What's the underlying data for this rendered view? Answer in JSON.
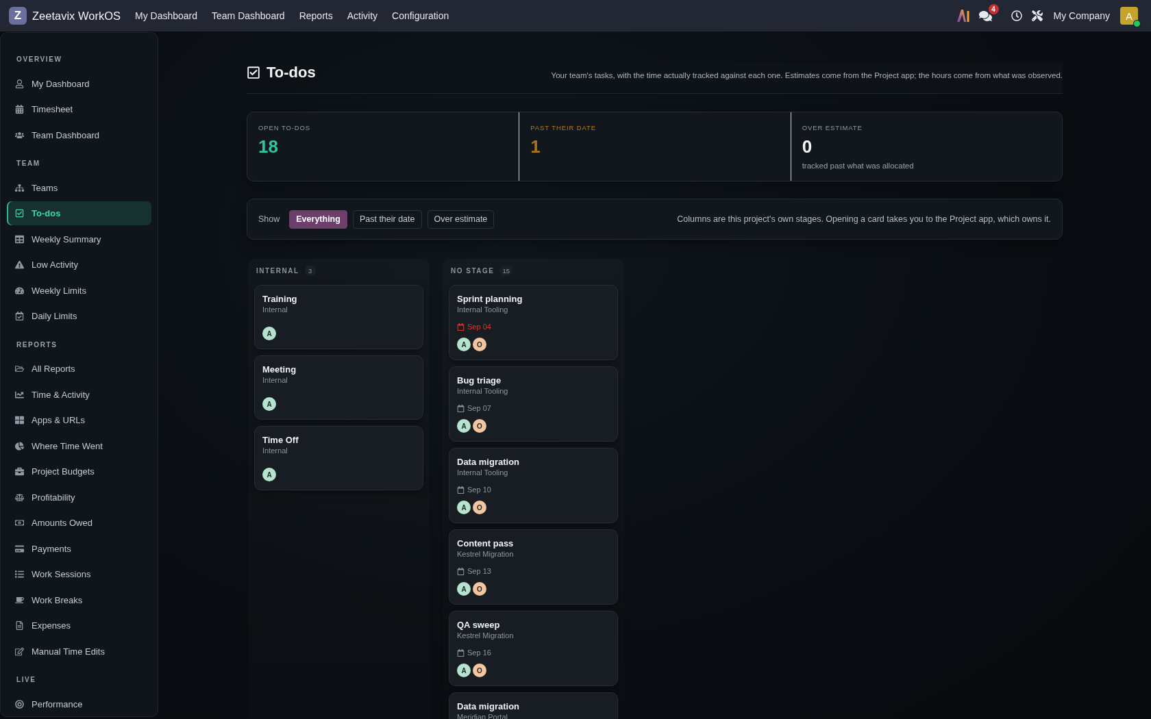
{
  "topbar": {
    "logo_letter": "Z",
    "brand": "Zeetavix WorkOS",
    "nav": [
      "My Dashboard",
      "Team Dashboard",
      "Reports",
      "Activity",
      "Configuration"
    ],
    "messages_badge": "4",
    "company": "My Company",
    "avatar": {
      "initial": "A",
      "online": true
    }
  },
  "sidebar": [
    {
      "heading": "OVERVIEW",
      "items": [
        {
          "label": "My Dashboard",
          "selected": false
        },
        {
          "label": "Timesheet",
          "selected": false
        },
        {
          "label": "Team Dashboard",
          "selected": false
        }
      ]
    },
    {
      "heading": "TEAM",
      "items": [
        {
          "label": "Teams",
          "selected": false
        },
        {
          "label": "To-dos",
          "selected": true
        },
        {
          "label": "Weekly Summary",
          "selected": false
        },
        {
          "label": "Low Activity",
          "selected": false
        },
        {
          "label": "Weekly Limits",
          "selected": false
        },
        {
          "label": "Daily Limits",
          "selected": false
        }
      ]
    },
    {
      "heading": "REPORTS",
      "items": [
        {
          "label": "All Reports",
          "selected": false
        },
        {
          "label": "Time & Activity",
          "selected": false
        },
        {
          "label": "Apps & URLs",
          "selected": false
        },
        {
          "label": "Where Time Went",
          "selected": false
        },
        {
          "label": "Project Budgets",
          "selected": false
        },
        {
          "label": "Profitability",
          "selected": false
        },
        {
          "label": "Amounts Owed",
          "selected": false
        },
        {
          "label": "Payments",
          "selected": false
        },
        {
          "label": "Work Sessions",
          "selected": false
        },
        {
          "label": "Work Breaks",
          "selected": false
        },
        {
          "label": "Expenses",
          "selected": false
        },
        {
          "label": "Manual Time Edits",
          "selected": false
        }
      ]
    },
    {
      "heading": "LIVE",
      "items": [
        {
          "label": "Performance",
          "selected": false
        }
      ]
    }
  ],
  "page": {
    "title": "To-dos",
    "description": "Your team's tasks, with the time actually tracked against each one. Estimates come from the Project app; the hours come from what was observed."
  },
  "stats": [
    {
      "kind": "accent",
      "label": "OPEN TO-DOS",
      "value": "18"
    },
    {
      "kind": "warning",
      "label": "PAST THEIR DATE",
      "value": "1"
    },
    {
      "kind": "plain",
      "label": "OVER ESTIMATE",
      "value": "0",
      "note": "tracked past what was allocated"
    }
  ],
  "filters": {
    "label": "Show",
    "chips": [
      {
        "label": "Everything",
        "selected": true
      },
      {
        "label": "Past their date",
        "selected": false
      },
      {
        "label": "Over estimate",
        "selected": false
      }
    ],
    "note": "Columns are this project's own stages. Opening a card takes you to the Project app, which owns it."
  },
  "columns": [
    {
      "title": "INTERNAL",
      "count": "3",
      "cards": [
        {
          "title": "Training",
          "project": "Internal",
          "assignees": [
            {
              "initial": "A",
              "color": "#b5e3cd"
            }
          ]
        },
        {
          "title": "Meeting",
          "project": "Internal",
          "assignees": [
            {
              "initial": "A",
              "color": "#b5e3cd"
            }
          ]
        },
        {
          "title": "Time Off",
          "project": "Internal",
          "assignees": [
            {
              "initial": "A",
              "color": "#b5e3cd"
            }
          ]
        }
      ]
    },
    {
      "title": "NO STAGE",
      "count": "15",
      "cards": [
        {
          "title": "Sprint planning",
          "project": "Internal Tooling",
          "date": "Sep 04",
          "overdue": true,
          "assignees": [
            {
              "initial": "A",
              "color": "#b5e3cd"
            },
            {
              "initial": "O",
              "color": "#f3c6a2"
            }
          ]
        },
        {
          "title": "Bug triage",
          "project": "Internal Tooling",
          "date": "Sep 07",
          "overdue": false,
          "assignees": [
            {
              "initial": "A",
              "color": "#b5e3cd"
            },
            {
              "initial": "O",
              "color": "#f3c6a2"
            }
          ]
        },
        {
          "title": "Data migration",
          "project": "Internal Tooling",
          "date": "Sep 10",
          "overdue": false,
          "assignees": [
            {
              "initial": "A",
              "color": "#b5e3cd"
            },
            {
              "initial": "O",
              "color": "#f3c6a2"
            }
          ]
        },
        {
          "title": "Content pass",
          "project": "Kestrel Migration",
          "date": "Sep 13",
          "overdue": false,
          "assignees": [
            {
              "initial": "A",
              "color": "#b5e3cd"
            },
            {
              "initial": "O",
              "color": "#f3c6a2"
            }
          ]
        },
        {
          "title": "QA sweep",
          "project": "Kestrel Migration",
          "date": "Sep 16",
          "overdue": false,
          "assignees": [
            {
              "initial": "A",
              "color": "#b5e3cd"
            },
            {
              "initial": "O",
              "color": "#f3c6a2"
            }
          ]
        },
        {
          "title": "Data migration",
          "project": "Meridian Portal"
        }
      ]
    }
  ]
}
